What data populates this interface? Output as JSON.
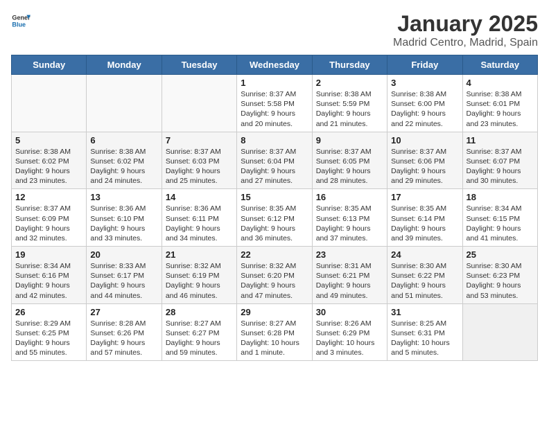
{
  "logo": {
    "general": "General",
    "blue": "Blue"
  },
  "title": "January 2025",
  "location": "Madrid Centro, Madrid, Spain",
  "weekdays": [
    "Sunday",
    "Monday",
    "Tuesday",
    "Wednesday",
    "Thursday",
    "Friday",
    "Saturday"
  ],
  "weeks": [
    [
      {
        "day": "",
        "content": ""
      },
      {
        "day": "",
        "content": ""
      },
      {
        "day": "",
        "content": ""
      },
      {
        "day": "1",
        "content": "Sunrise: 8:37 AM\nSunset: 5:58 PM\nDaylight: 9 hours\nand 20 minutes."
      },
      {
        "day": "2",
        "content": "Sunrise: 8:38 AM\nSunset: 5:59 PM\nDaylight: 9 hours\nand 21 minutes."
      },
      {
        "day": "3",
        "content": "Sunrise: 8:38 AM\nSunset: 6:00 PM\nDaylight: 9 hours\nand 22 minutes."
      },
      {
        "day": "4",
        "content": "Sunrise: 8:38 AM\nSunset: 6:01 PM\nDaylight: 9 hours\nand 23 minutes."
      }
    ],
    [
      {
        "day": "5",
        "content": "Sunrise: 8:38 AM\nSunset: 6:02 PM\nDaylight: 9 hours\nand 23 minutes."
      },
      {
        "day": "6",
        "content": "Sunrise: 8:38 AM\nSunset: 6:02 PM\nDaylight: 9 hours\nand 24 minutes."
      },
      {
        "day": "7",
        "content": "Sunrise: 8:37 AM\nSunset: 6:03 PM\nDaylight: 9 hours\nand 25 minutes."
      },
      {
        "day": "8",
        "content": "Sunrise: 8:37 AM\nSunset: 6:04 PM\nDaylight: 9 hours\nand 27 minutes."
      },
      {
        "day": "9",
        "content": "Sunrise: 8:37 AM\nSunset: 6:05 PM\nDaylight: 9 hours\nand 28 minutes."
      },
      {
        "day": "10",
        "content": "Sunrise: 8:37 AM\nSunset: 6:06 PM\nDaylight: 9 hours\nand 29 minutes."
      },
      {
        "day": "11",
        "content": "Sunrise: 8:37 AM\nSunset: 6:07 PM\nDaylight: 9 hours\nand 30 minutes."
      }
    ],
    [
      {
        "day": "12",
        "content": "Sunrise: 8:37 AM\nSunset: 6:09 PM\nDaylight: 9 hours\nand 32 minutes."
      },
      {
        "day": "13",
        "content": "Sunrise: 8:36 AM\nSunset: 6:10 PM\nDaylight: 9 hours\nand 33 minutes."
      },
      {
        "day": "14",
        "content": "Sunrise: 8:36 AM\nSunset: 6:11 PM\nDaylight: 9 hours\nand 34 minutes."
      },
      {
        "day": "15",
        "content": "Sunrise: 8:35 AM\nSunset: 6:12 PM\nDaylight: 9 hours\nand 36 minutes."
      },
      {
        "day": "16",
        "content": "Sunrise: 8:35 AM\nSunset: 6:13 PM\nDaylight: 9 hours\nand 37 minutes."
      },
      {
        "day": "17",
        "content": "Sunrise: 8:35 AM\nSunset: 6:14 PM\nDaylight: 9 hours\nand 39 minutes."
      },
      {
        "day": "18",
        "content": "Sunrise: 8:34 AM\nSunset: 6:15 PM\nDaylight: 9 hours\nand 41 minutes."
      }
    ],
    [
      {
        "day": "19",
        "content": "Sunrise: 8:34 AM\nSunset: 6:16 PM\nDaylight: 9 hours\nand 42 minutes."
      },
      {
        "day": "20",
        "content": "Sunrise: 8:33 AM\nSunset: 6:17 PM\nDaylight: 9 hours\nand 44 minutes."
      },
      {
        "day": "21",
        "content": "Sunrise: 8:32 AM\nSunset: 6:19 PM\nDaylight: 9 hours\nand 46 minutes."
      },
      {
        "day": "22",
        "content": "Sunrise: 8:32 AM\nSunset: 6:20 PM\nDaylight: 9 hours\nand 47 minutes."
      },
      {
        "day": "23",
        "content": "Sunrise: 8:31 AM\nSunset: 6:21 PM\nDaylight: 9 hours\nand 49 minutes."
      },
      {
        "day": "24",
        "content": "Sunrise: 8:30 AM\nSunset: 6:22 PM\nDaylight: 9 hours\nand 51 minutes."
      },
      {
        "day": "25",
        "content": "Sunrise: 8:30 AM\nSunset: 6:23 PM\nDaylight: 9 hours\nand 53 minutes."
      }
    ],
    [
      {
        "day": "26",
        "content": "Sunrise: 8:29 AM\nSunset: 6:25 PM\nDaylight: 9 hours\nand 55 minutes."
      },
      {
        "day": "27",
        "content": "Sunrise: 8:28 AM\nSunset: 6:26 PM\nDaylight: 9 hours\nand 57 minutes."
      },
      {
        "day": "28",
        "content": "Sunrise: 8:27 AM\nSunset: 6:27 PM\nDaylight: 9 hours\nand 59 minutes."
      },
      {
        "day": "29",
        "content": "Sunrise: 8:27 AM\nSunset: 6:28 PM\nDaylight: 10 hours\nand 1 minute."
      },
      {
        "day": "30",
        "content": "Sunrise: 8:26 AM\nSunset: 6:29 PM\nDaylight: 10 hours\nand 3 minutes."
      },
      {
        "day": "31",
        "content": "Sunrise: 8:25 AM\nSunset: 6:31 PM\nDaylight: 10 hours\nand 5 minutes."
      },
      {
        "day": "",
        "content": ""
      }
    ]
  ]
}
